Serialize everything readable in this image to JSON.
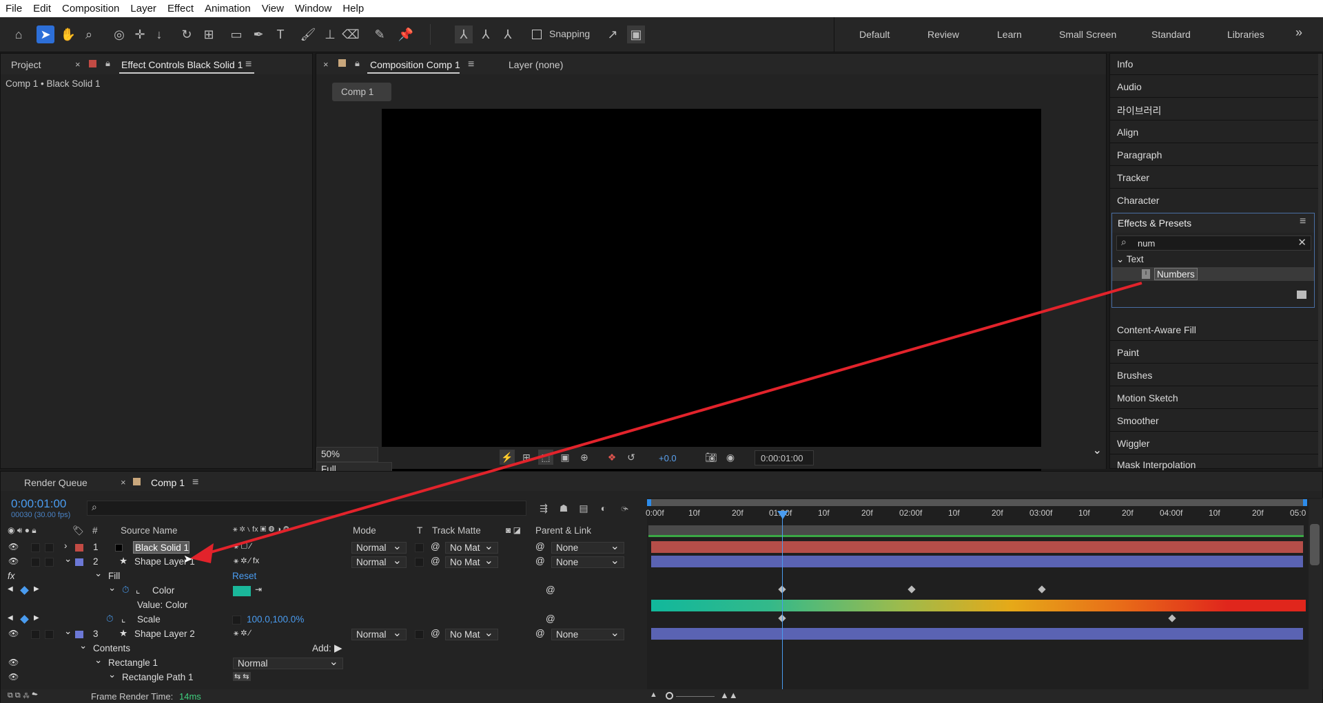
{
  "menu": [
    "File",
    "Edit",
    "Composition",
    "Layer",
    "Effect",
    "Animation",
    "View",
    "Window",
    "Help"
  ],
  "toolbar": {
    "snapping": "Snapping",
    "workspaces": [
      "Default",
      "Review",
      "Learn",
      "Small Screen",
      "Standard",
      "Libraries"
    ],
    "more": "»"
  },
  "left_panel": {
    "tab_project": "Project",
    "tab_effect_controls": "Effect Controls Black Solid 1",
    "subtitle": "Comp 1 • Black Solid 1"
  },
  "comp_panel": {
    "tab_comp": "Composition Comp 1",
    "tab_layer": "Layer (none)",
    "breadcrumb": "Comp 1",
    "zoom": "50%",
    "quality": "Full",
    "exposure": "+0.0",
    "timecode": "0:00:01:00"
  },
  "right_panel": {
    "top_items": [
      "Info",
      "Audio",
      "라이브러리",
      "Align",
      "Paragraph",
      "Tracker",
      "Character"
    ],
    "effects_title": "Effects & Presets",
    "search_value": "num",
    "category": "Text",
    "preset": "Numbers",
    "bottom_items": [
      "Content-Aware Fill",
      "Paint",
      "Brushes",
      "Motion Sketch",
      "Smoother",
      "Wiggler",
      "Mask Interpolation"
    ]
  },
  "timeline": {
    "tab_render": "Render Queue",
    "tab_comp": "Comp 1",
    "timecode": "0:00:01:00",
    "fps": "00030 (30.00 fps)",
    "headers": {
      "num": "#",
      "source": "Source Name",
      "mode": "Mode",
      "t": "T",
      "track": "Track Matte",
      "parent": "Parent & Link"
    },
    "ruler": [
      "0:00f",
      "10f",
      "20f",
      "01:00f",
      "10f",
      "20f",
      "02:00f",
      "10f",
      "20f",
      "03:00f",
      "10f",
      "20f",
      "04:00f",
      "10f",
      "20f",
      "05:0"
    ],
    "layers": [
      {
        "num": "1",
        "name": "Black Solid 1",
        "mode": "Normal",
        "matte": "No Mat",
        "parent": "None",
        "color": "#c24b44"
      },
      {
        "num": "2",
        "name": "Shape Layer 1",
        "mode": "Normal",
        "matte": "No Mat",
        "parent": "None",
        "color": "#6c78d6"
      },
      {
        "num": "3",
        "name": "Shape Layer 2",
        "mode": "Normal",
        "matte": "No Mat",
        "parent": "None",
        "color": "#6c78d6"
      }
    ],
    "fx": "fx",
    "fill": "Fill",
    "reset": "Reset",
    "color_prop": "Color",
    "value_color": "Value: Color",
    "scale": "Scale",
    "scale_value": "100.0,100.0%",
    "contents": "Contents",
    "add": "Add:",
    "rect1": "Rectangle 1",
    "rect_mode": "Normal",
    "rect_path": "Rectangle Path 1",
    "render_time_label": "Frame Render Time:",
    "render_time": "14ms"
  },
  "colors": {
    "accent": "#2d8ceb",
    "solid": "#b54e49",
    "shape": "#5a63b3",
    "teal": "#1ab79a",
    "arrow": "#e2232b"
  }
}
